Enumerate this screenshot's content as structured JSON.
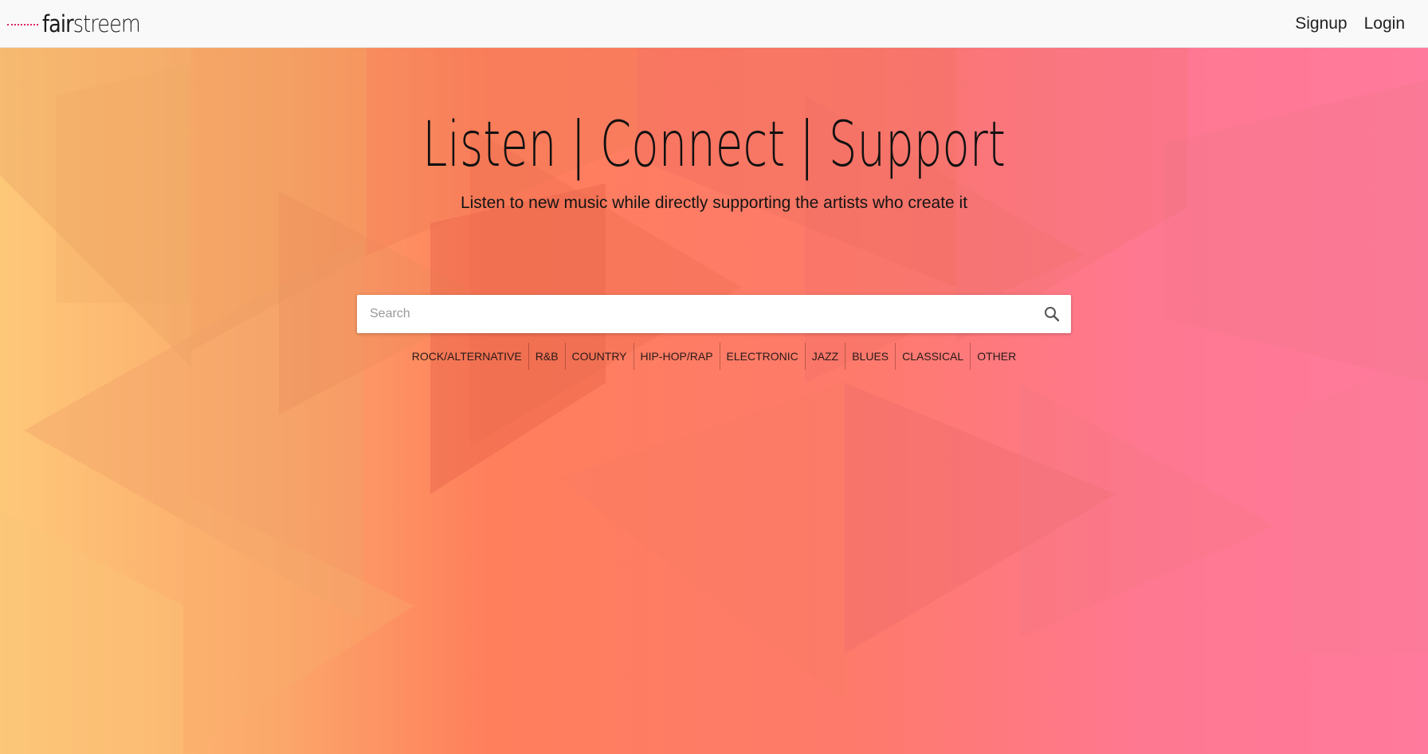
{
  "brand": {
    "name_part1": "fair",
    "name_part2": "streem"
  },
  "nav": {
    "signup_label": "Signup",
    "login_label": "Login"
  },
  "hero": {
    "title": "Listen | Connect | Support",
    "subtitle": "Listen to new music while directly supporting the artists who create it"
  },
  "search": {
    "placeholder": "Search",
    "value": "",
    "icon": "search-icon"
  },
  "genres": [
    "ROCK/ALTERNATIVE",
    "R&B",
    "COUNTRY",
    "HIP-HOP/RAP",
    "ELECTRONIC",
    "JAZZ",
    "BLUES",
    "CLASSICAL",
    "OTHER"
  ],
  "colors": {
    "brand_accent": "#e0245e",
    "gradient_start": "#fec879",
    "gradient_mid": "#ff7f5c",
    "gradient_end": "#ff7a9c",
    "navbar_bg": "#f9f9f9"
  }
}
